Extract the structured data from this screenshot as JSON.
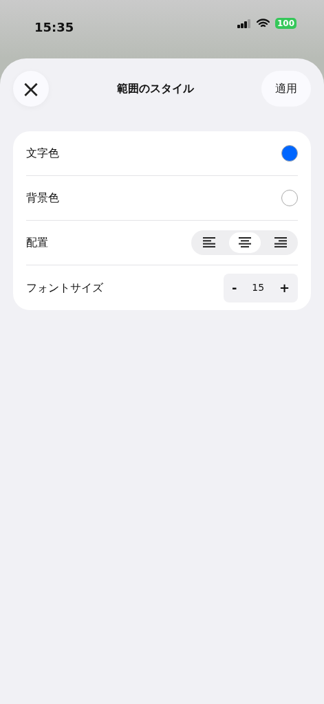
{
  "status_bar": {
    "time": "15:35",
    "battery": "100"
  },
  "header": {
    "close": "×",
    "title": "範囲のスタイル",
    "apply": "適用"
  },
  "rows": [
    {
      "kind": "color",
      "label": "文字色",
      "color": "#0066ff"
    },
    {
      "kind": "color",
      "label": "背景色",
      "color": "#ffffff"
    },
    {
      "kind": "align",
      "label": "配置",
      "options": [
        {
          "kind": "left",
          "selected": false
        },
        {
          "kind": "center",
          "selected": true
        },
        {
          "kind": "right",
          "selected": false
        }
      ]
    },
    {
      "kind": "stepper",
      "label": "フォントサイズ",
      "minus": "-",
      "value": "15",
      "plus": "+"
    }
  ]
}
